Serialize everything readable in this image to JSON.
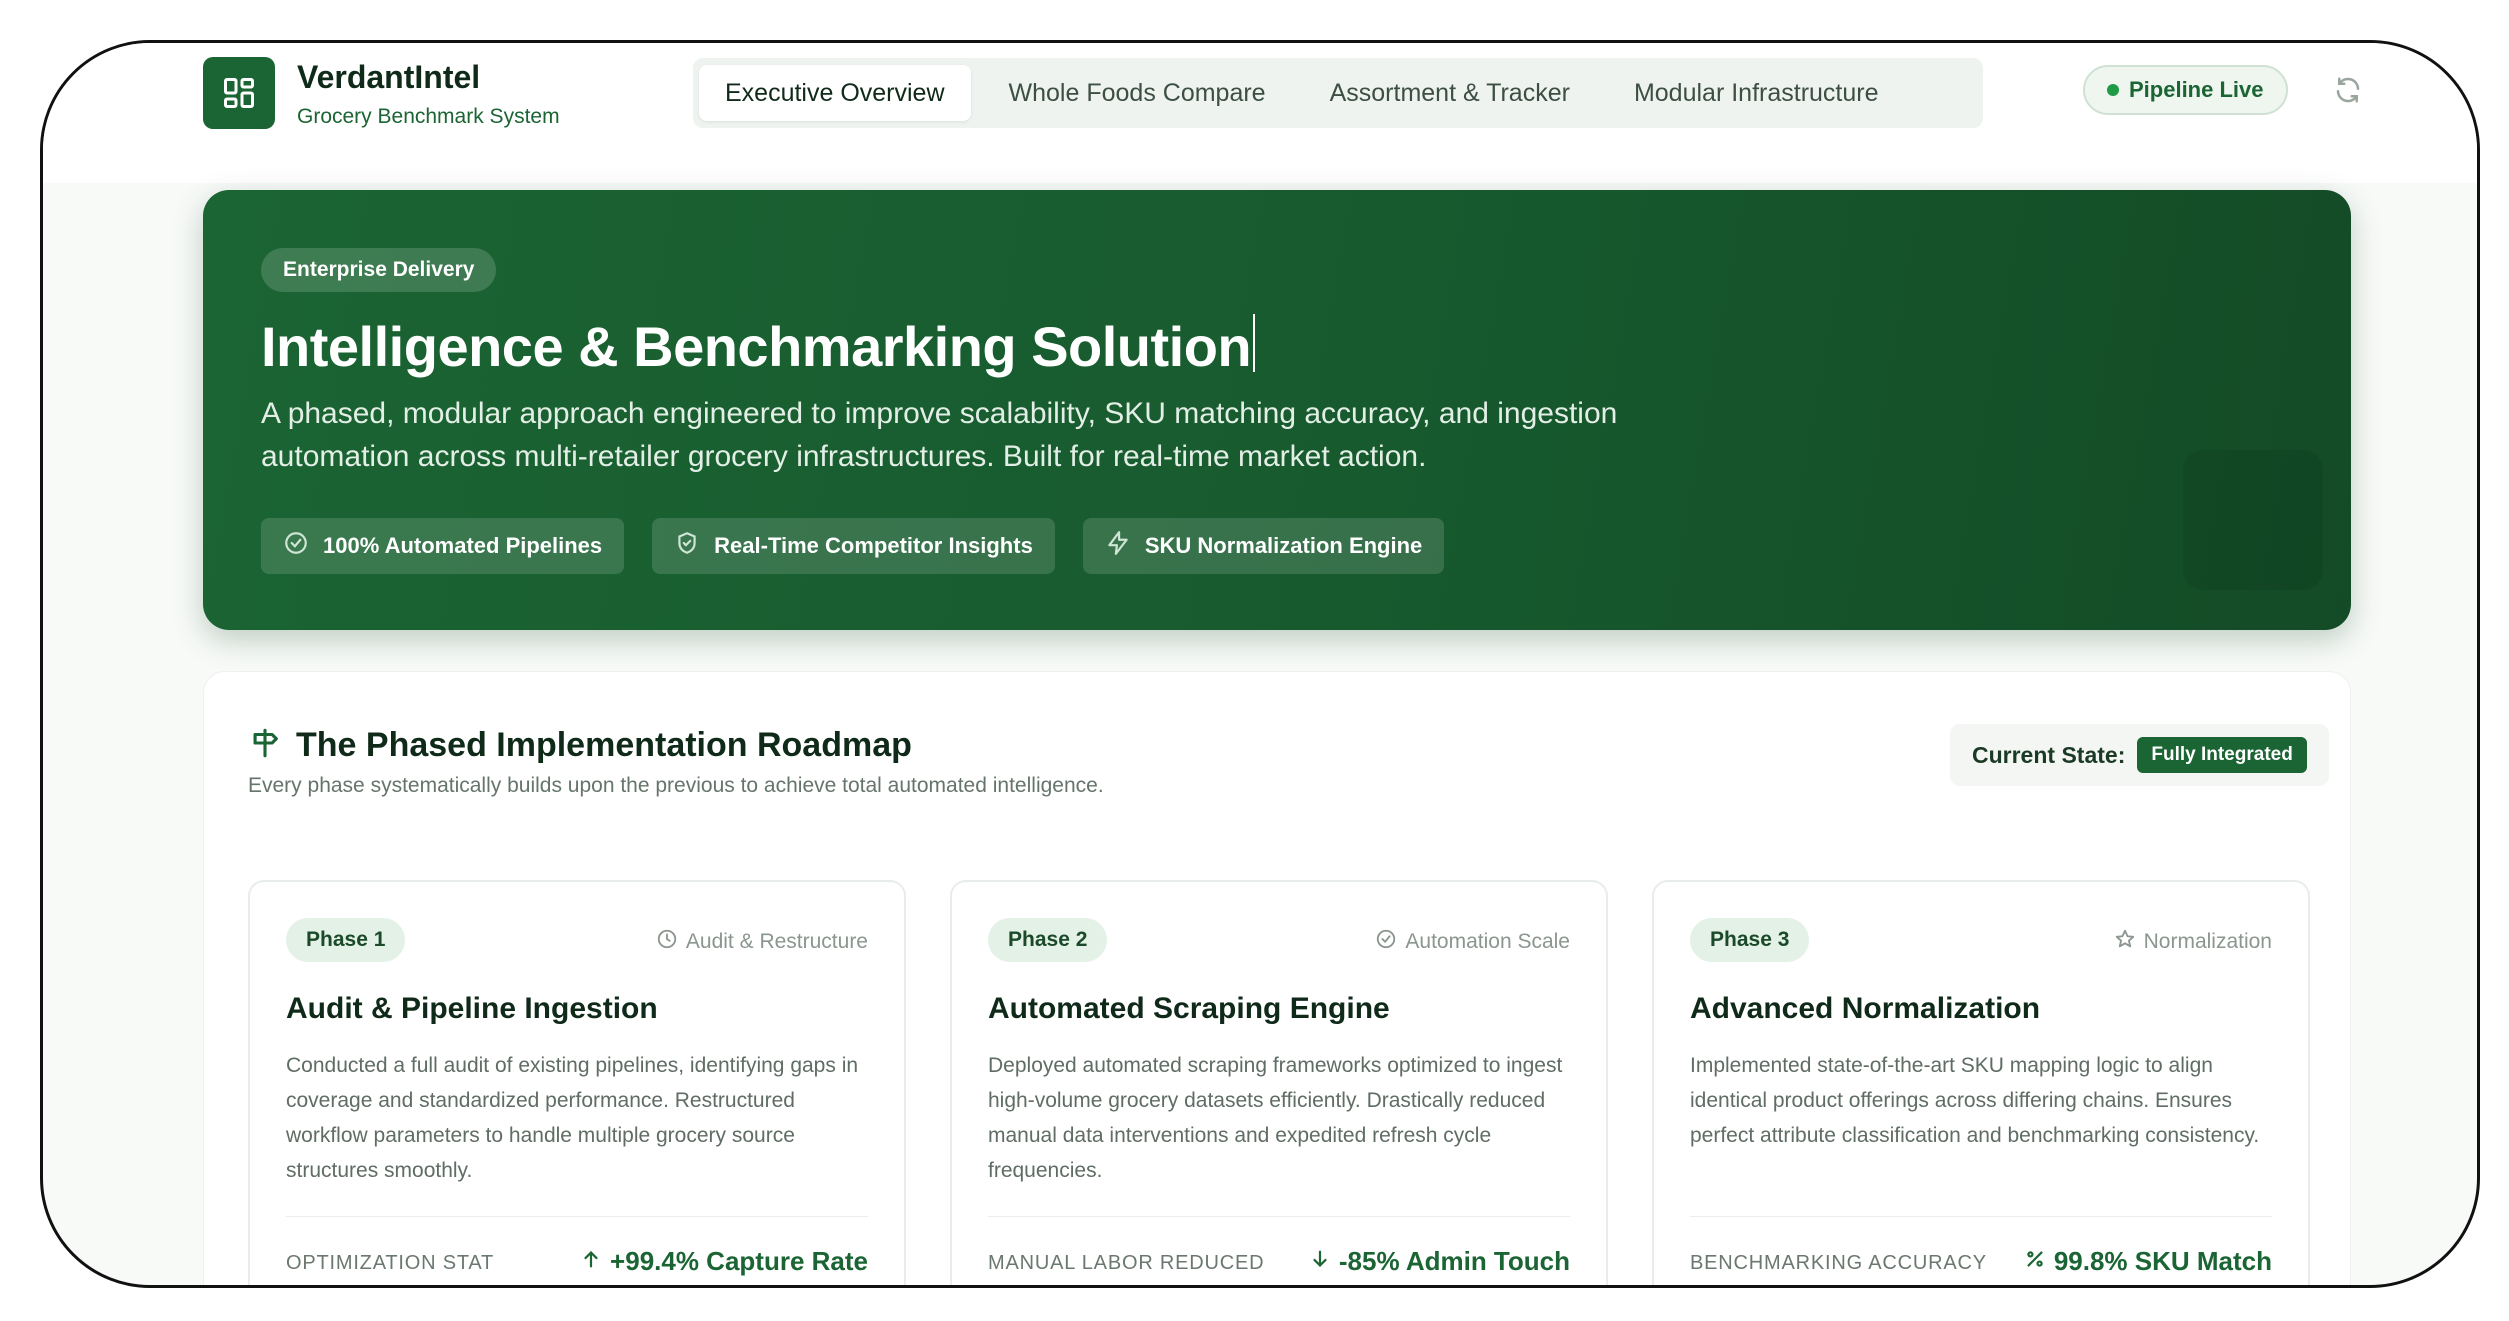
{
  "brand": {
    "title": "VerdantIntel",
    "subtitle": "Grocery Benchmark System",
    "logo_icon": "dashboard-grid-icon",
    "accent_color": "#1b6433"
  },
  "nav": {
    "tabs": [
      {
        "label": "Executive Overview",
        "active": true
      },
      {
        "label": "Whole Foods Compare",
        "active": false
      },
      {
        "label": "Assortment & Tracker",
        "active": false
      },
      {
        "label": "Modular Infrastructure",
        "active": false
      }
    ]
  },
  "status": {
    "pipeline_label": "Pipeline Live",
    "dot_color": "#1f9a45",
    "refresh_icon": "refresh-icon"
  },
  "hero": {
    "badge": "Enterprise Delivery",
    "title": "Intelligence & Benchmarking Solution",
    "description": "A phased, modular approach engineered to improve scalability, SKU matching accuracy, and ingestion automation across multi-retailer grocery infrastructures. Built for real-time market action.",
    "chips": [
      {
        "icon": "check-circle-icon",
        "label": "100% Automated Pipelines"
      },
      {
        "icon": "shield-check-icon",
        "label": "Real-Time Competitor Insights"
      },
      {
        "icon": "lightning-icon",
        "label": "SKU Normalization Engine"
      }
    ]
  },
  "roadmap": {
    "icon": "signpost-icon",
    "title": "The Phased Implementation Roadmap",
    "subtitle": "Every phase systematically builds upon the previous to achieve total automated intelligence.",
    "state_label": "Current State:",
    "state_value": "Fully Integrated",
    "phases": [
      {
        "badge": "Phase 1",
        "tag_icon": "clock-icon",
        "tag": "Audit & Restructure",
        "title": "Audit & Pipeline Ingestion",
        "description": "Conducted a full audit of existing pipelines, identifying gaps in coverage and standardized performance. Restructured workflow parameters to handle multiple grocery source structures smoothly.",
        "stat_label": "OPTIMIZATION STAT",
        "stat_icon": "arrow-up-icon",
        "stat_value": "+99.4% Capture Rate"
      },
      {
        "badge": "Phase 2",
        "tag_icon": "check-circle-icon",
        "tag": "Automation Scale",
        "title": "Automated Scraping Engine",
        "description": "Deployed automated scraping frameworks optimized to ingest high-volume grocery datasets efficiently. Drastically reduced manual data interventions and expedited refresh cycle frequencies.",
        "stat_label": "MANUAL LABOR REDUCED",
        "stat_icon": "arrow-down-icon",
        "stat_value": "-85% Admin Touch"
      },
      {
        "badge": "Phase 3",
        "tag_icon": "star-icon",
        "tag": "Normalization",
        "title": "Advanced Normalization",
        "description": "Implemented state-of-the-art SKU mapping logic to align identical product offerings across differing chains. Ensures perfect attribute classification and benchmarking consistency.",
        "stat_label": "BENCHMARKING ACCURACY",
        "stat_icon": "percent-icon",
        "stat_value": "99.8% SKU Match"
      }
    ]
  }
}
